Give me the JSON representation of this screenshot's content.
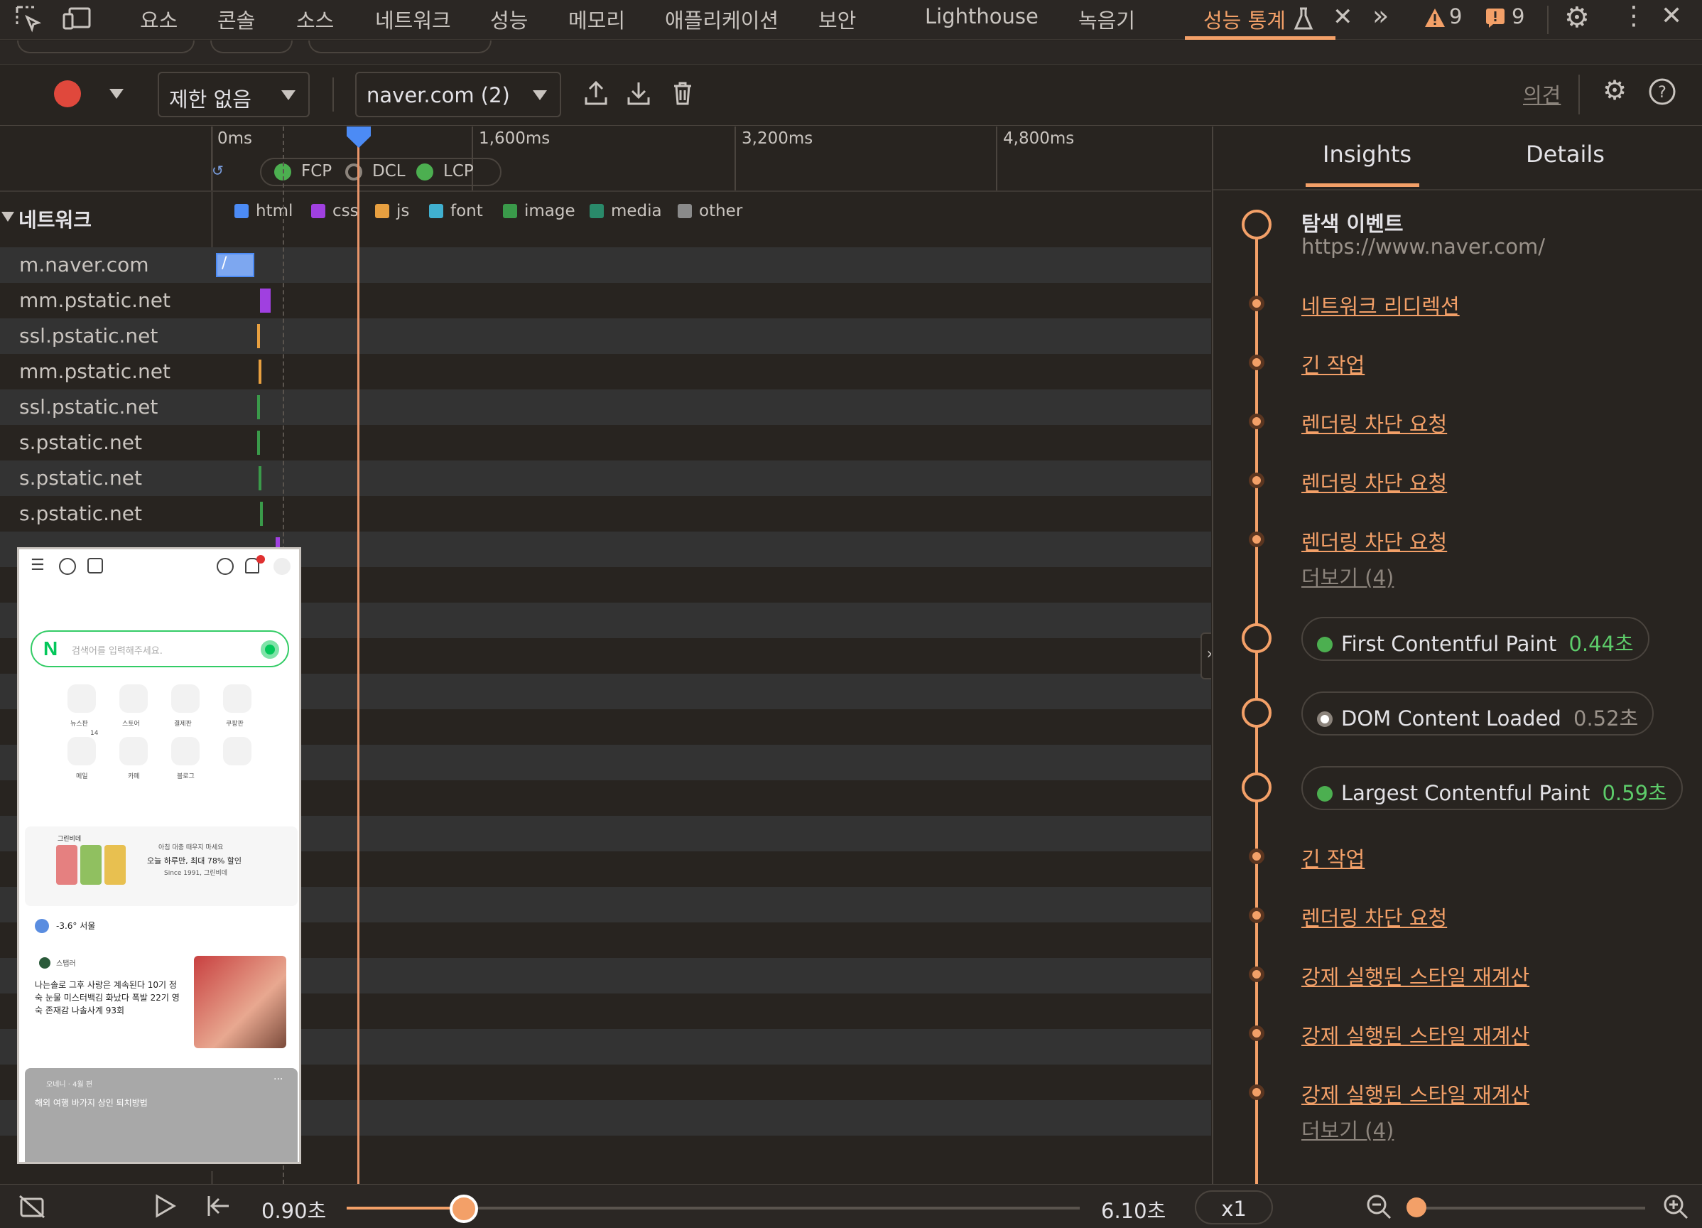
{
  "tabs": [
    "요소",
    "콘솔",
    "소스",
    "네트워크",
    "성능",
    "메모리",
    "애플리케이션",
    "보안",
    "Lighthouse",
    "녹음기",
    "성능 통계"
  ],
  "warnings": {
    "warn_count": "9",
    "issue_count": "9"
  },
  "toolbar": {
    "throttle": "제한 없음",
    "target": "naver.com (2)",
    "feedback": "의견"
  },
  "timeline": {
    "ticks": [
      "0ms",
      "1,600ms",
      "3,200ms",
      "4,800ms"
    ],
    "markers": [
      "FCP",
      "DCL",
      "LCP"
    ]
  },
  "network": {
    "title": "네트워크",
    "legend": [
      {
        "label": "html",
        "color": "#4c8bf5"
      },
      {
        "label": "css",
        "color": "#a040e0"
      },
      {
        "label": "js",
        "color": "#e8a040"
      },
      {
        "label": "font",
        "color": "#40b0d0"
      },
      {
        "label": "image",
        "color": "#3a9a4a"
      },
      {
        "label": "media",
        "color": "#2a8a6a"
      },
      {
        "label": "other",
        "color": "#8a8a8a"
      }
    ],
    "rows": [
      "m.naver.com",
      "mm.pstatic.net",
      "ssl.pstatic.net",
      "mm.pstatic.net",
      "ssl.pstatic.net",
      "s.pstatic.net",
      "s.pstatic.net",
      "s.pstatic.net"
    ],
    "first_bar_label": "/"
  },
  "insights": {
    "tabs": [
      "Insights",
      "Details"
    ],
    "nav_title": "탐색 이벤트",
    "nav_url": "https://www.naver.com/",
    "items_a": [
      "네트워크 리디렉션",
      "긴 작업",
      "렌더링 차단 요청",
      "렌더링 차단 요청",
      "렌더링 차단 요청"
    ],
    "more_a": "더보기 (4)",
    "metrics": [
      {
        "name": "First Contentful Paint",
        "value": "0.44초",
        "color": "#4caf50"
      },
      {
        "name": "DOM Content Loaded",
        "value": "0.52초",
        "color": "#ffffff"
      },
      {
        "name": "Largest Contentful Paint",
        "value": "0.59초",
        "color": "#4caf50"
      }
    ],
    "items_b": [
      "긴 작업",
      "렌더링 차단 요청",
      "강제 실행된 스타일 재계산",
      "강제 실행된 스타일 재계산",
      "강제 실행된 스타일 재계산"
    ],
    "more_b": "더보기 (4)"
  },
  "playback": {
    "current": "0.90초",
    "end": "6.10초",
    "speed": "x1",
    "progress": 0.16
  },
  "preview": {
    "search_placeholder": "검색어를 입력해주세요.",
    "icon_labels": [
      "뉴스판",
      "스토어",
      "결제판",
      "쿠팡판",
      "메일",
      "카페",
      "블로그",
      ""
    ],
    "badge": "14",
    "ad_brand": "그린비데",
    "ad_text1": "아침 대충 때우지 마세요",
    "ad_text2": "오늘 하루만, 최대 78% 할인",
    "ad_text3": "Since 1991, 그린비데",
    "weather": "-3.6° 서울",
    "news_source": "스탭러",
    "news_text": "나는솔로 그후 사랑은 계속된다 10기 정숙 눈물 미스터백김 화났다 폭발 22기 영숙 존재감 나솔사계 93회",
    "card_meta": "오네니 · 4월 편",
    "card_title": "해외 여행 바가지 상인 퇴치방법"
  }
}
